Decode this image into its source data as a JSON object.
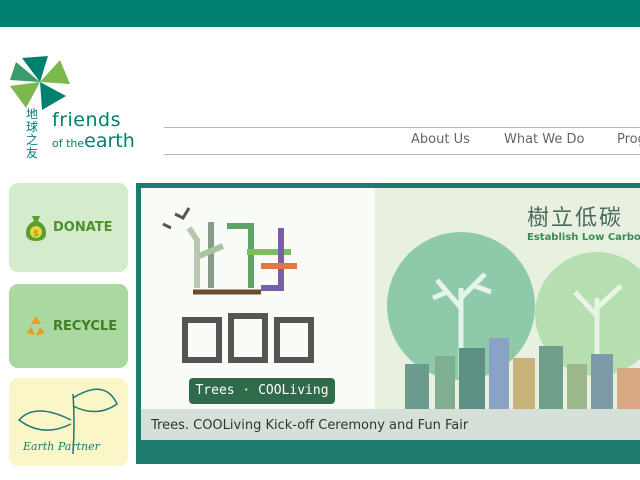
{
  "brand": {
    "name_cn": "地球之友",
    "name_line1": "friends",
    "name_line2_small": "of the",
    "name_line2_big": "earth",
    "color": "#00806f"
  },
  "nav": {
    "items": [
      "About Us",
      "What We Do",
      "Prog"
    ]
  },
  "sidebar": {
    "donate": {
      "label": "DONATE",
      "icon": "money-bag-icon"
    },
    "recycle": {
      "label": "RECYCLE",
      "icon": "recycle-icon"
    },
    "partner": {
      "label": "Earth Partner",
      "icon": "leaf-logo-icon"
    }
  },
  "banner": {
    "left_title_cn": "樹 酷生活",
    "left_badge": "Trees · COOLiving",
    "right_title_cn": "樹立低碳",
    "right_subtitle": "Establish Low Carbon",
    "caption": "Trees. COOLiving Kick-off Ceremony and Fun Fair"
  }
}
